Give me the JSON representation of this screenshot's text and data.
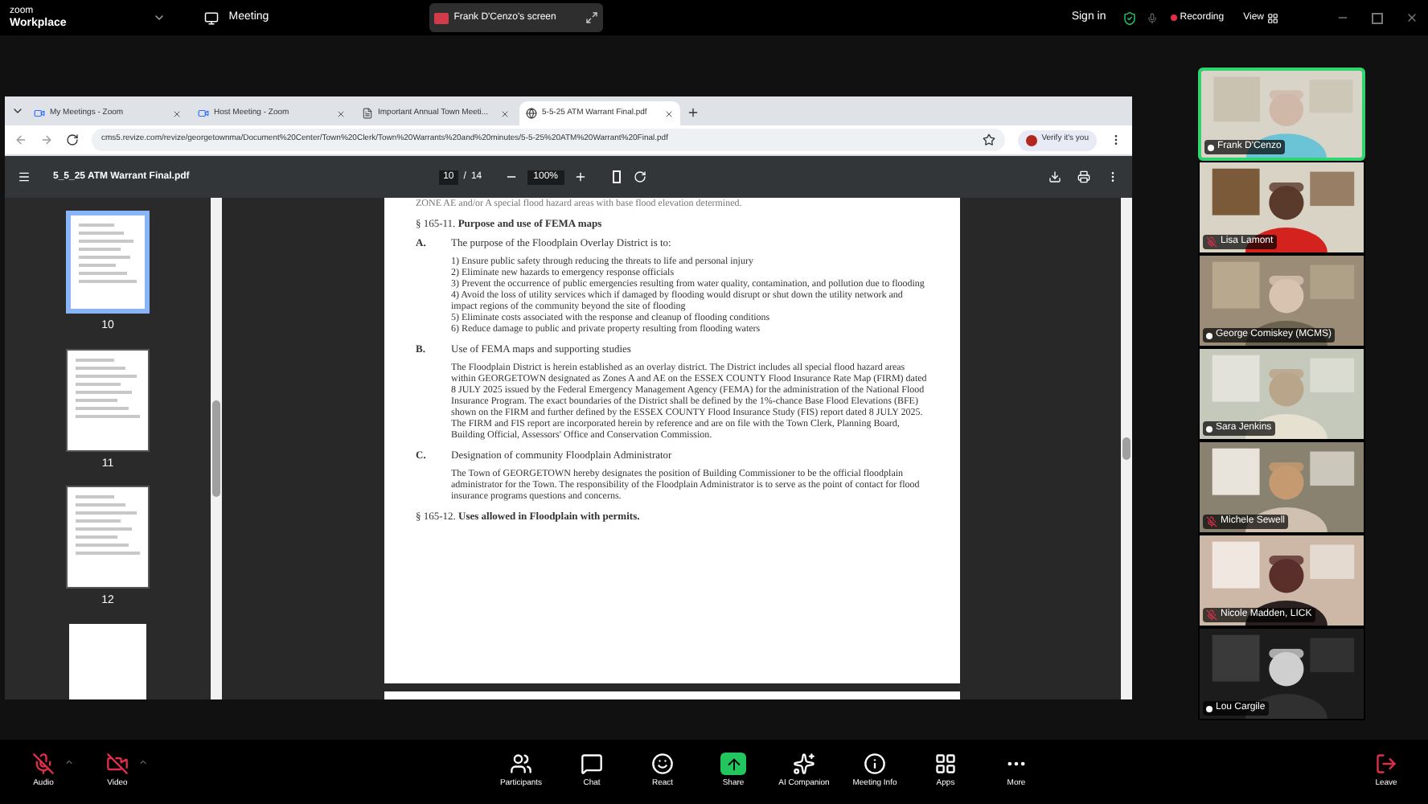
{
  "zoom_bar": {
    "app": "zoom",
    "app_sub": "Workplace",
    "meeting": "Meeting",
    "share_banner": "Frank D'Cenzo's screen",
    "sign_in": "Sign in",
    "recording": "Recording",
    "view": "View"
  },
  "browser": {
    "tabs": [
      {
        "title": "My Meetings - Zoom",
        "selected": false
      },
      {
        "title": "Host Meeting - Zoom",
        "selected": false
      },
      {
        "title": "Important Annual Town Meeti...",
        "selected": false
      },
      {
        "title": "5-5-25 ATM Warrant Final.pdf",
        "selected": true
      }
    ],
    "url": "cms5.revize.com/revize/georgetownma/Document%20Center/Town%20Clerk/Town%20Warrants%20and%20minutes/5-5-25%20ATM%20Warrant%20Final.pdf",
    "verify": "Verify it's you"
  },
  "pdf": {
    "file_name": "5_5_25 ATM Warrant Final.pdf",
    "page_current": "10",
    "page_sep": "/",
    "page_total": "14",
    "zoom": "100%",
    "thumbnails": [
      {
        "label": "10",
        "selected": true
      },
      {
        "label": "11",
        "selected": false
      },
      {
        "label": "12",
        "selected": false
      }
    ],
    "document": {
      "cut_line": "ZONE AE and/or A special flood hazard areas with base flood elevation determined.",
      "blocks": [
        {
          "kind": "heading",
          "text": "§ 165-11. **Purpose and use of FEMA maps**"
        },
        {
          "kind": "section",
          "letter": "A.",
          "title": "The purpose of the Floodplain Overlay District is to:",
          "lines": [
            "1) Ensure public safety through reducing the threats to life and personal injury",
            "2) Eliminate new hazards to emergency response officials",
            "3) Prevent the occurrence of public emergencies resulting from water quality, contamination, and pollution due to flooding",
            "4) Avoid the loss of utility services which if damaged by flooding would disrupt or shut down the utility network and impact regions of the community beyond the site of flooding",
            "5) Eliminate costs associated with the response and cleanup of flooding conditions",
            "6) Reduce damage to public and private property resulting from flooding waters"
          ]
        },
        {
          "kind": "section",
          "letter": "B.",
          "title": "Use of FEMA maps and supporting studies",
          "lines": [
            "The Floodplain District is herein established as an overlay district. The District includes all special flood hazard areas within GEORGETOWN designated as Zones A and AE on the ESSEX COUNTY Flood Insurance Rate Map (FIRM) dated 8 JULY 2025 issued by the Federal Emergency Management Agency (FEMA) for the administration of the National Flood Insurance Program. The exact boundaries of the District shall be defined by the 1%-chance Base Flood Elevations (BFE) shown on the FIRM and further defined by the ESSEX COUNTY Flood Insurance Study (FIS) report dated 8 JULY 2025. The FIRM and FIS report are incorporated herein by reference and are on file with the Town Clerk, Planning Board, Building Official, Assessors' Office and Conservation Commission."
          ]
        },
        {
          "kind": "section",
          "letter": "C.",
          "title": "Designation of community Floodplain Administrator",
          "lines": [
            "The Town of GEORGETOWN hereby designates the position of Building Commissioner to be the official floodplain administrator for the Town. The responsibility of the Floodplain Administrator is to serve as the point of contact for flood insurance programs questions and concerns."
          ]
        },
        {
          "kind": "heading",
          "text": "§ 165-12. **Uses allowed in Floodplain with permits.**"
        }
      ]
    }
  },
  "participants": [
    {
      "name": "Frank D'Cenzo",
      "speaking": true,
      "muted": false
    },
    {
      "name": "Lisa Lamont",
      "speaking": false,
      "muted": true
    },
    {
      "name": "George Comiskey (MCMS)",
      "speaking": false,
      "muted": false
    },
    {
      "name": "Sara Jenkins",
      "speaking": false,
      "muted": false
    },
    {
      "name": "Michele Sewell",
      "speaking": false,
      "muted": true
    },
    {
      "name": "Nicole Madden, LICK",
      "speaking": false,
      "muted": true
    },
    {
      "name": "Lou Cargile",
      "speaking": false,
      "muted": false
    }
  ],
  "toolbar_left": [
    {
      "kind": "audio",
      "label": "Audio",
      "off": true
    },
    {
      "kind": "video",
      "label": "Video",
      "off": true
    }
  ],
  "toolbar_center": [
    {
      "kind": "participants",
      "label": "Participants"
    },
    {
      "kind": "chat",
      "label": "Chat"
    },
    {
      "kind": "react",
      "label": "React"
    },
    {
      "kind": "share",
      "label": "Share"
    },
    {
      "kind": "ai",
      "label": "AI Companion"
    },
    {
      "kind": "info",
      "label": "Meeting Info"
    },
    {
      "kind": "apps",
      "label": "Apps"
    },
    {
      "kind": "more",
      "label": "More"
    }
  ],
  "leave": {
    "label": "Leave"
  }
}
